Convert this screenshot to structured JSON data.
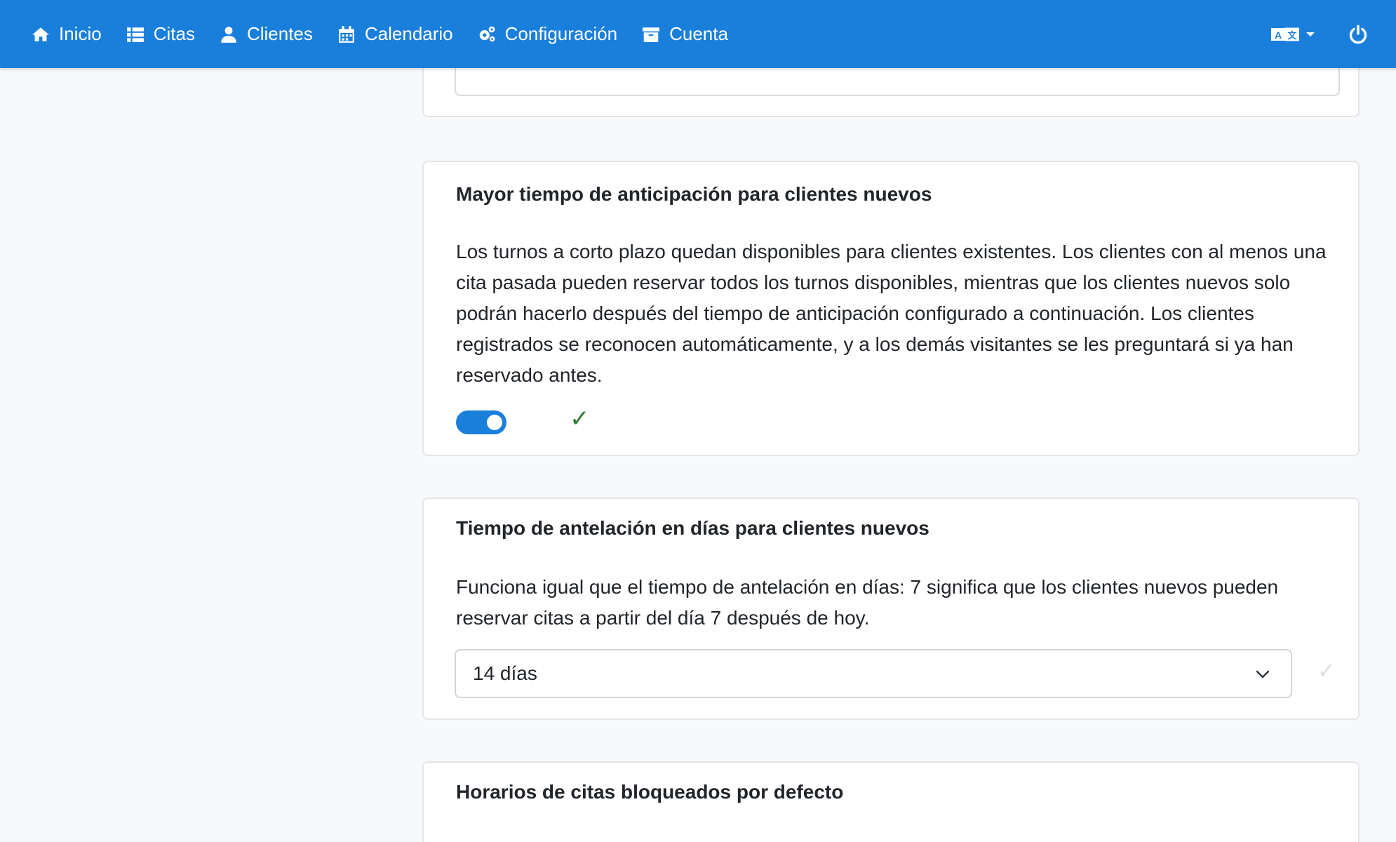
{
  "navbar": {
    "items": [
      {
        "label": "Inicio",
        "icon": "home-icon"
      },
      {
        "label": "Citas",
        "icon": "list-icon"
      },
      {
        "label": "Clientes",
        "icon": "user-icon"
      },
      {
        "label": "Calendario",
        "icon": "calendar-icon"
      },
      {
        "label": "Configuración",
        "icon": "gears-icon"
      },
      {
        "label": "Cuenta",
        "icon": "archive-icon"
      }
    ],
    "language_icon": "translate-icon",
    "power_icon": "power-icon",
    "background_color": "#1a7fdb"
  },
  "cards": {
    "anticipation": {
      "title": "Mayor tiempo de anticipación para clientes nuevos",
      "description": "Los turnos a corto plazo quedan disponibles para clientes existentes. Los clientes con al menos una cita pasada pueden reservar todos los turnos disponibles, mientras que los clientes nuevos solo podrán hacerlo después del tiempo de anticipación configurado a continuación. Los clientes registrados se reconocen automáticamente, y a los demás visitantes se les preguntará si ya han reservado antes.",
      "toggle_on": true,
      "status_mark": "✓"
    },
    "leadtime": {
      "title": "Tiempo de antelación en días para clientes nuevos",
      "description": "Funciona igual que el tiempo de antelación en días: 7 significa que los clientes nuevos pueden reservar citas a partir del día 7 después de hoy.",
      "selected_value": "14 días",
      "status_mark": "✓"
    },
    "blocked": {
      "title": "Horarios de citas bloqueados por defecto"
    }
  },
  "colors": {
    "accent": "#1a7fdb",
    "success": "#2e7d32"
  }
}
